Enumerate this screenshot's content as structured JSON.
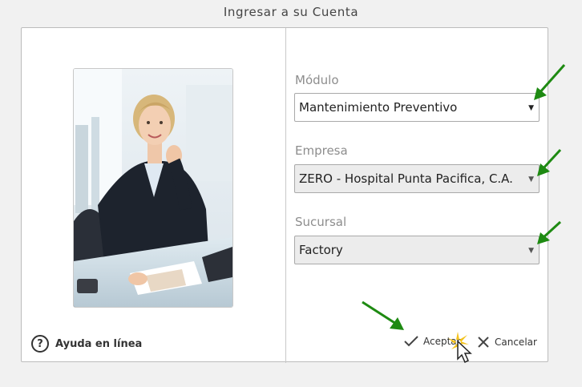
{
  "window": {
    "title": "Ingresar a su Cuenta"
  },
  "help": {
    "label": "Ayuda en línea",
    "icon": "help-circle-icon"
  },
  "form": {
    "modulo": {
      "label": "Módulo",
      "value": "Mantenimiento Preventivo"
    },
    "empresa": {
      "label": "Empresa",
      "value": "ZERO - Hospital Punta Pacifica, C.A."
    },
    "sucursal": {
      "label": "Sucursal",
      "value": "Factory"
    }
  },
  "actions": {
    "accept_label": "Aceptar",
    "cancel_label": "Cancelar"
  },
  "colors": {
    "annotation_arrow": "#1e8a12",
    "label_gray": "#8d8d8d",
    "disabled_bg": "#ececec",
    "cursor_flash": "#f4c21a"
  }
}
